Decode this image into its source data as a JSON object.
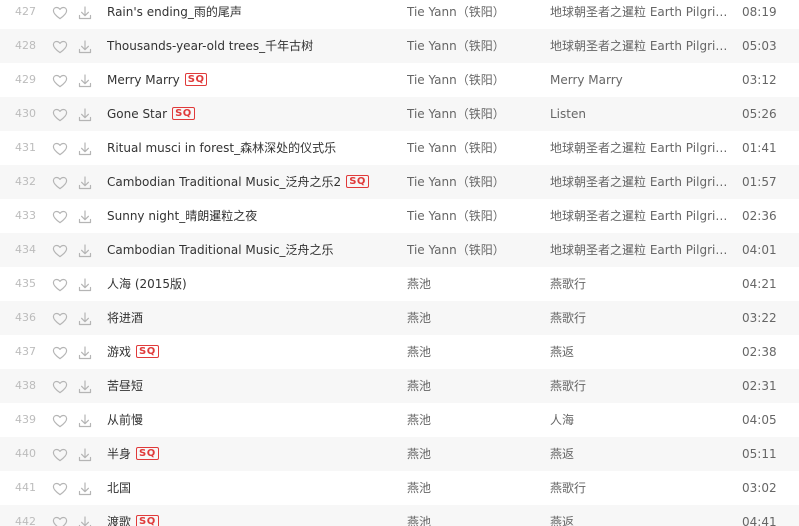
{
  "tracks": [
    {
      "num": "427",
      "title": "Rain's ending_雨的尾声",
      "sq": false,
      "artist": "Tie Yann（铁阳）",
      "album": "地球朝圣者之暹粒 Earth Pilgrim: Siem Reap",
      "duration": "08:19"
    },
    {
      "num": "428",
      "title": "Thousands-year-old trees_千年古树",
      "sq": false,
      "artist": "Tie Yann（铁阳）",
      "album": "地球朝圣者之暹粒 Earth Pilgrim: Siem Reap",
      "duration": "05:03"
    },
    {
      "num": "429",
      "title": "Merry Marry",
      "sq": true,
      "artist": "Tie Yann（铁阳）",
      "album": "Merry Marry",
      "duration": "03:12"
    },
    {
      "num": "430",
      "title": "Gone Star",
      "sq": true,
      "artist": "Tie Yann（铁阳）",
      "album": "Listen",
      "duration": "05:26"
    },
    {
      "num": "431",
      "title": "Ritual musci in forest_森林深处的仪式乐",
      "sq": false,
      "artist": "Tie Yann（铁阳）",
      "album": "地球朝圣者之暹粒 Earth Pilgrim: Siem Reap",
      "duration": "01:41"
    },
    {
      "num": "432",
      "title": "Cambodian Traditional Music_泛舟之乐2",
      "sq": true,
      "artist": "Tie Yann（铁阳）",
      "album": "地球朝圣者之暹粒 Earth Pilgrim: Siem Reap",
      "duration": "01:57"
    },
    {
      "num": "433",
      "title": "Sunny night_晴朗暹粒之夜",
      "sq": false,
      "artist": "Tie Yann（铁阳）",
      "album": "地球朝圣者之暹粒 Earth Pilgrim: Siem Reap",
      "duration": "02:36"
    },
    {
      "num": "434",
      "title": "Cambodian Traditional Music_泛舟之乐",
      "sq": false,
      "artist": "Tie Yann（铁阳）",
      "album": "地球朝圣者之暹粒 Earth Pilgrim: Siem Reap",
      "duration": "04:01"
    },
    {
      "num": "435",
      "title": "人海 (2015版)",
      "sq": false,
      "artist": "燕池",
      "album": "燕歌行",
      "duration": "04:21"
    },
    {
      "num": "436",
      "title": "将进酒",
      "sq": false,
      "artist": "燕池",
      "album": "燕歌行",
      "duration": "03:22"
    },
    {
      "num": "437",
      "title": "游戏",
      "sq": true,
      "artist": "燕池",
      "album": "燕返",
      "duration": "02:38"
    },
    {
      "num": "438",
      "title": "苦昼短",
      "sq": false,
      "artist": "燕池",
      "album": "燕歌行",
      "duration": "02:31"
    },
    {
      "num": "439",
      "title": "从前慢",
      "sq": false,
      "artist": "燕池",
      "album": "人海",
      "duration": "04:05"
    },
    {
      "num": "440",
      "title": "半身",
      "sq": true,
      "artist": "燕池",
      "album": "燕返",
      "duration": "05:11"
    },
    {
      "num": "441",
      "title": "北国",
      "sq": false,
      "artist": "燕池",
      "album": "燕歌行",
      "duration": "03:02"
    },
    {
      "num": "442",
      "title": "渡歌",
      "sq": true,
      "artist": "燕池",
      "album": "燕返",
      "duration": "04:41"
    }
  ],
  "sq_label": "SQ",
  "icons": {
    "like": "heart-outline-icon",
    "download": "download-icon"
  },
  "colors": {
    "row_alt_bg": "#f7f7f7",
    "sq_red": "#e03a3a",
    "number_gray": "#bcbcbc",
    "icon_gray": "#b5b5b5"
  }
}
